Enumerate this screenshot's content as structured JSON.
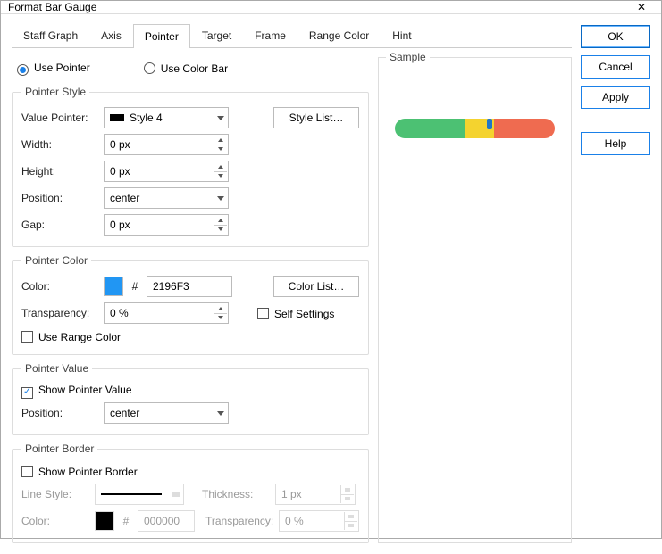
{
  "title": "Format Bar Gauge",
  "tabs": [
    "Staff Graph",
    "Axis",
    "Pointer",
    "Target",
    "Frame",
    "Range Color",
    "Hint"
  ],
  "active_tab": 2,
  "radios": {
    "use_pointer": "Use Pointer",
    "use_color_bar": "Use Color Bar",
    "selected": "use_pointer"
  },
  "pointer_style": {
    "legend": "Pointer Style",
    "value_pointer_lbl": "Value Pointer:",
    "value_pointer": "Style 4",
    "style_list_btn": "Style List…",
    "width_lbl": "Width:",
    "width": "0 px",
    "height_lbl": "Height:",
    "height": "0 px",
    "position_lbl": "Position:",
    "position": "center",
    "gap_lbl": "Gap:",
    "gap": "0 px"
  },
  "pointer_color": {
    "legend": "Pointer Color",
    "color_lbl": "Color:",
    "color_hex": "2196F3",
    "swatch": "#2196F3",
    "color_list_btn": "Color List…",
    "transparency_lbl": "Transparency:",
    "transparency": "0 %",
    "self_settings": "Self Settings",
    "use_range_color": "Use Range Color"
  },
  "pointer_value": {
    "legend": "Pointer Value",
    "show": "Show Pointer Value",
    "show_checked": true,
    "position_lbl": "Position:",
    "position": "center"
  },
  "pointer_border": {
    "legend": "Pointer Border",
    "show": "Show Pointer Border",
    "line_style_lbl": "Line Style:",
    "thickness_lbl": "Thickness:",
    "thickness": "1 px",
    "color_lbl": "Color:",
    "color_hex": "000000",
    "swatch": "#000000",
    "transparency_lbl": "Transparency:",
    "transparency": "0 %"
  },
  "sample_label": "Sample",
  "buttons": {
    "ok": "OK",
    "cancel": "Cancel",
    "apply": "Apply",
    "help": "Help"
  },
  "hash": "#"
}
